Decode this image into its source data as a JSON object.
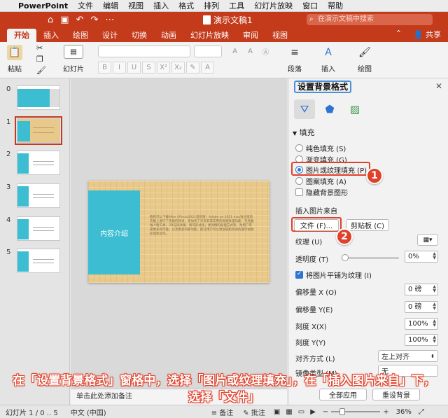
{
  "menubar": {
    "app": "PowerPoint",
    "items": [
      "文件",
      "编辑",
      "视图",
      "插入",
      "格式",
      "排列",
      "工具",
      "幻灯片放映",
      "窗口",
      "帮助"
    ]
  },
  "window": {
    "title": "演示文稿1",
    "search_placeholder": "在演示文稿中搜索"
  },
  "ribbon": {
    "tabs": [
      "开始",
      "插入",
      "绘图",
      "设计",
      "切换",
      "动画",
      "幻灯片放映",
      "审阅",
      "视图"
    ],
    "active_tab": "开始",
    "share": "共享",
    "buttons": {
      "paste": "粘贴",
      "slides": "幻灯片",
      "paragraph": "段落",
      "insert": "插入",
      "draw": "绘图"
    }
  },
  "thumbnails": [
    {
      "num": "0"
    },
    {
      "num": "1"
    },
    {
      "num": "2"
    },
    {
      "num": "3"
    },
    {
      "num": "4"
    },
    {
      "num": "5"
    }
  ],
  "slide": {
    "box_title": "内容介绍",
    "body_text": "教程可以下载After Effects2021直装版！Adobe ae 2021 mac独立版首次推上进行了性能的改进，更加优了许多非常实用的视频处理功能，包括曲线人物工具、3D渲染效果、将可形式化，更流畅的处理方式等，为用户带来更多的可能，以及更多的新功能，能让用户可以更加轻松高效的进行视频处理和创作。"
  },
  "notes": {
    "placeholder": "单击此处添加备注"
  },
  "format_pane": {
    "title": "设置背景格式",
    "section_fill": "填充",
    "options": {
      "solid": "纯色填充 (S)",
      "gradient": "渐变填充 (G)",
      "picture": "图片或纹理填充 (P)",
      "pattern": "图案填充 (A)",
      "hide_bg": "隐藏背景图形"
    },
    "insert_from": "插入图片来自",
    "file_button": "文件 (F)...",
    "clipboard_button": "剪贴板 (C)",
    "texture": "纹理 (U)",
    "transparency": "透明度 (T)",
    "transparency_value": "0%",
    "transparency_level": 0,
    "tile": "将图片平铺为纹理 (I)",
    "offset_x": "偏移量 X (O)",
    "offset_x_value": "0 磅",
    "offset_y": "偏移量 Y(E)",
    "offset_y_value": "0 磅",
    "scale_x": "刻度 X(X)",
    "scale_x_value": "100%",
    "scale_y": "刻度 Y(Y)",
    "scale_y_value": "100%",
    "align": "对齐方式 (L)",
    "align_value": "左上对齐",
    "mirror": "镜像类型 (M)",
    "mirror_value": "无",
    "apply_all": "全部应用",
    "reset_bg": "重设背景",
    "badge1": "1",
    "badge2": "2"
  },
  "status": {
    "slide_info": "幻灯片 1 / 0 .. 5",
    "language": "中文 (中国)",
    "notes": "备注",
    "comments": "批注",
    "zoom": "36%"
  },
  "caption": {
    "text": "在「设置背景格式」窗格中，选择「图片或纹理填充」，在「插入图片来自」下，选择「文件」"
  },
  "colors": {
    "accent": "#c43b1c",
    "slide_blue": "#3dbdd1",
    "highlight": "#e0412a"
  }
}
